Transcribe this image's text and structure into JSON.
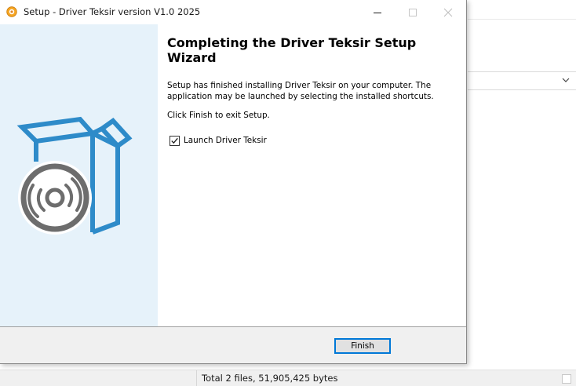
{
  "window": {
    "title": "Setup - Driver Teksir version V1.0 2025"
  },
  "wizard": {
    "heading": "Completing the Driver Teksir Setup Wizard",
    "description": "Setup has finished installing Driver Teksir on your computer. The application may be launched by selecting the installed shortcuts.",
    "exit_hint": "Click Finish to exit Setup.",
    "launch_label": "Launch Driver Teksir",
    "launch_checked": true,
    "finish_label": "Finish"
  },
  "background": {
    "status_text": "Total 2 files, 51,905,425 bytes"
  },
  "icons": {
    "app": "setup-app-icon",
    "minimize": "minimize-icon",
    "maximize": "maximize-icon",
    "close": "close-icon",
    "dropdown": "chevron-down-icon",
    "graphic": "box-with-disc-icon"
  },
  "colors": {
    "side_panel": "#e6f2fa",
    "graphic_blue": "#2e8bc9",
    "disc_gray": "#6d6d6d",
    "focus_border": "#0078d7"
  }
}
